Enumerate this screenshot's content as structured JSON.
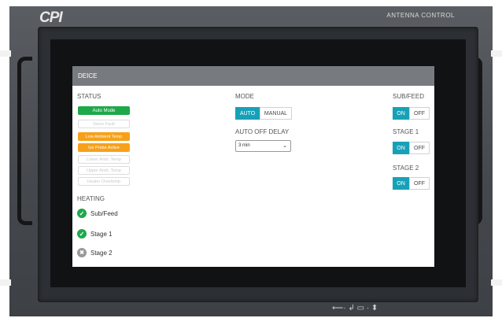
{
  "device": {
    "logo": "CPI",
    "model": "ANTENNA CONTROL",
    "ports": "⟵· ↲ ▭ · ⬍"
  },
  "panel": {
    "title": "DEICE",
    "status": {
      "heading": "STATUS",
      "badges": [
        {
          "label": "Auto Mode",
          "state": "green"
        },
        {
          "label": "Deice Fault",
          "state": "off"
        },
        {
          "label": "Low Ambient Temp",
          "state": "orange"
        },
        {
          "label": "Ice Probe Active",
          "state": "orange"
        },
        {
          "label": "Lower Amb. Temp",
          "state": "off"
        },
        {
          "label": "Upper Amb. Temp",
          "state": "off"
        },
        {
          "label": "Heater Overtemp",
          "state": "off"
        }
      ]
    },
    "heating": {
      "heading": "HEATING",
      "items": [
        {
          "label": "Sub/Feed",
          "state": "on",
          "icon": "check-icon"
        },
        {
          "label": "Stage 1",
          "state": "on",
          "icon": "check-icon"
        },
        {
          "label": "Stage 2",
          "state": "off",
          "icon": "x-icon"
        }
      ]
    },
    "mode": {
      "heading": "MODE",
      "options": [
        "AUTO",
        "MANUAL"
      ],
      "selected": "AUTO"
    },
    "auto_off_delay": {
      "heading": "AUTO OFF DELAY",
      "value": "3 min"
    },
    "toggles": [
      {
        "heading": "SUB/FEED",
        "on_label": "ON",
        "off_label": "OFF",
        "value": "ON"
      },
      {
        "heading": "STAGE 1",
        "on_label": "ON",
        "off_label": "OFF",
        "value": "ON"
      },
      {
        "heading": "STAGE 2",
        "on_label": "ON",
        "off_label": "OFF",
        "value": "ON"
      }
    ]
  },
  "colors": {
    "accent": "#17a1b8",
    "ok": "#1ea84a",
    "warn": "#f7a11a",
    "header": "#777b80"
  }
}
